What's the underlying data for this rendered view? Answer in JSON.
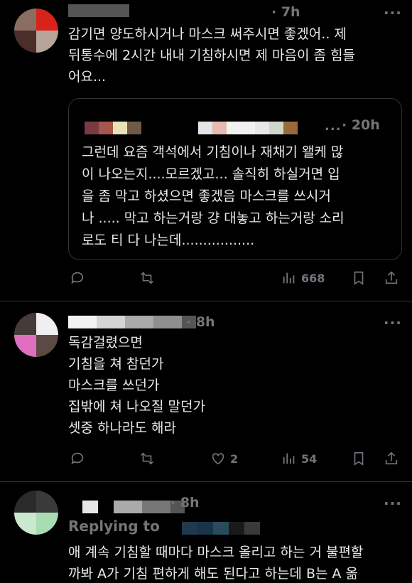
{
  "tweets": [
    {
      "time": "· 7h",
      "more": "···",
      "text": "감기면 양도하시거나 마스크 써주시면 좋겠어.. 제\n뒤통수에 2시간 내내 기침하시면 제 마음이 좀 힘들\n어요...",
      "quote": {
        "time": "· 20h",
        "more": "...",
        "text": "그런데 요즘 객석에서 기침이나 재채기 왤케 많\n이 나오는지....모르겠고... 솔직히 하실거면 입\n을 좀 막고 하셨으면 좋겠음 마스크를 쓰시거\n나 ..... 막고 하는거랑 걍 대놓고 하는거랑 소리\n로도 티 다 나는데................."
      },
      "views": "668"
    },
    {
      "time": "· 8h",
      "more": "···",
      "text": "독감걸렸으면\n기침을 쳐 참던가\n마스크를 쓰던가\n집밖에 쳐 나오질 말던가\n셋중 하나라도 해라",
      "likes": "2",
      "views": "54"
    },
    {
      "time": "· 8h",
      "more": "···",
      "replying": "Replying to",
      "text": "애 계속 기침할 때마다 마스크 올리고 하는 거 불편할\n까봐 A가 기침 편하게 해도 된다고 하는데 B는 A 옮"
    }
  ],
  "icons": {
    "reply": "reply-icon",
    "retweet": "retweet-icon",
    "like": "heart-icon",
    "views": "views-icon",
    "bookmark": "bookmark-icon",
    "share": "share-icon",
    "more": "more-icon"
  },
  "colors": {
    "background": "#000000",
    "text": "#e7e9ea",
    "muted": "#71767b",
    "border": "#2f3336"
  }
}
